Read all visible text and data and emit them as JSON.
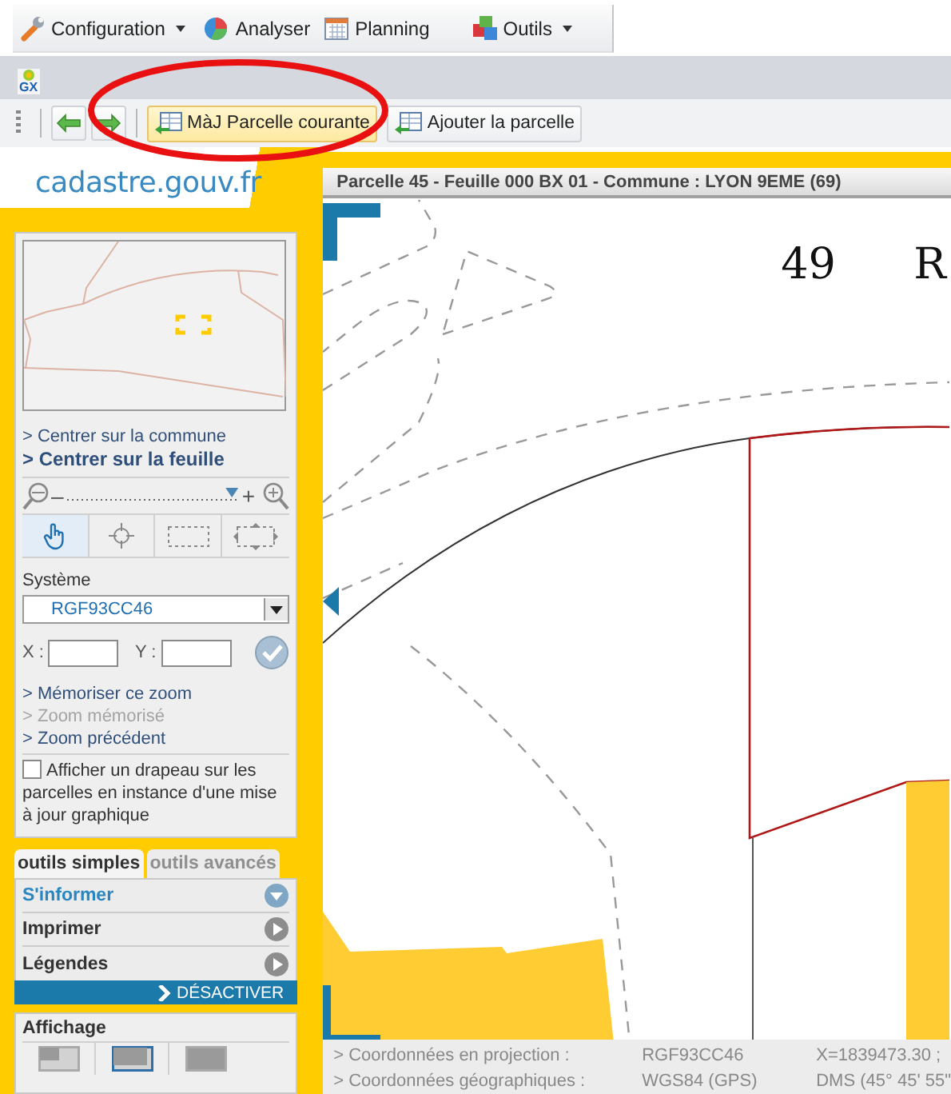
{
  "menu_bar": {
    "items": [
      {
        "label": "Configuration",
        "dropdown": true
      },
      {
        "label": "Analyser",
        "dropdown": false
      },
      {
        "label": "Planning",
        "dropdown": false
      },
      {
        "label": "Outils",
        "dropdown": true
      }
    ]
  },
  "gx_logo": "GX",
  "toolbar": {
    "buttons": [
      {
        "label": "MàJ Parcelle courante",
        "selected": true
      },
      {
        "label": "Ajouter la parcelle",
        "selected": false
      }
    ]
  },
  "logo": "cadastre.gouv.fr",
  "side_panel": {
    "center_links": [
      {
        "label": "> Centrer sur la commune",
        "emphasized": false
      },
      {
        "label": "> Centrer sur la feuille",
        "emphasized": true
      }
    ],
    "zoom": {
      "minus": "–",
      "plus": "+",
      "level": 0.96
    },
    "tools": [
      {
        "selected": true
      },
      {
        "selected": false
      },
      {
        "selected": false
      },
      {
        "selected": false
      }
    ],
    "system_label": "Système",
    "system_value": "RGF93CC46",
    "x_label": "X :",
    "y_label": "Y :",
    "zoom_links": [
      {
        "label": "> Mémoriser ce zoom",
        "disabled": false
      },
      {
        "label": "> Zoom mémorisé",
        "disabled": true
      },
      {
        "label": "> Zoom précédent",
        "disabled": false
      }
    ],
    "flag_option": {
      "label": "Afficher un drapeau sur les parcelles en instance d'une mise à jour graphique",
      "checked": false
    },
    "tabs": [
      {
        "label": "outils simples",
        "selected": true
      },
      {
        "label": "outils avancés",
        "selected": false
      }
    ],
    "sections": [
      {
        "label": "S'informer",
        "expanded": true
      },
      {
        "label": "Imprimer",
        "expanded": false
      },
      {
        "label": "Légendes",
        "expanded": false
      }
    ],
    "deactivate": "DÉSACTIVER",
    "display": {
      "title": "Affichage",
      "options": [
        {
          "selected": false
        },
        {
          "selected": true
        },
        {
          "selected": false
        }
      ]
    }
  },
  "map": {
    "title": "Parcelle 45 - Feuille 000 BX 01 - Commune : LYON 9EME (69)",
    "labels": [
      "49",
      "R"
    ]
  },
  "status_bar": {
    "rows": [
      {
        "label": "> Coordonnées en projection :",
        "system": "RGF93CC46",
        "value": "X=1839473.30 ;"
      },
      {
        "label": "> Coordonnées géographiques :",
        "system": "WGS84 (GPS)",
        "value": "DMS (45° 45' 55\""
      }
    ]
  }
}
